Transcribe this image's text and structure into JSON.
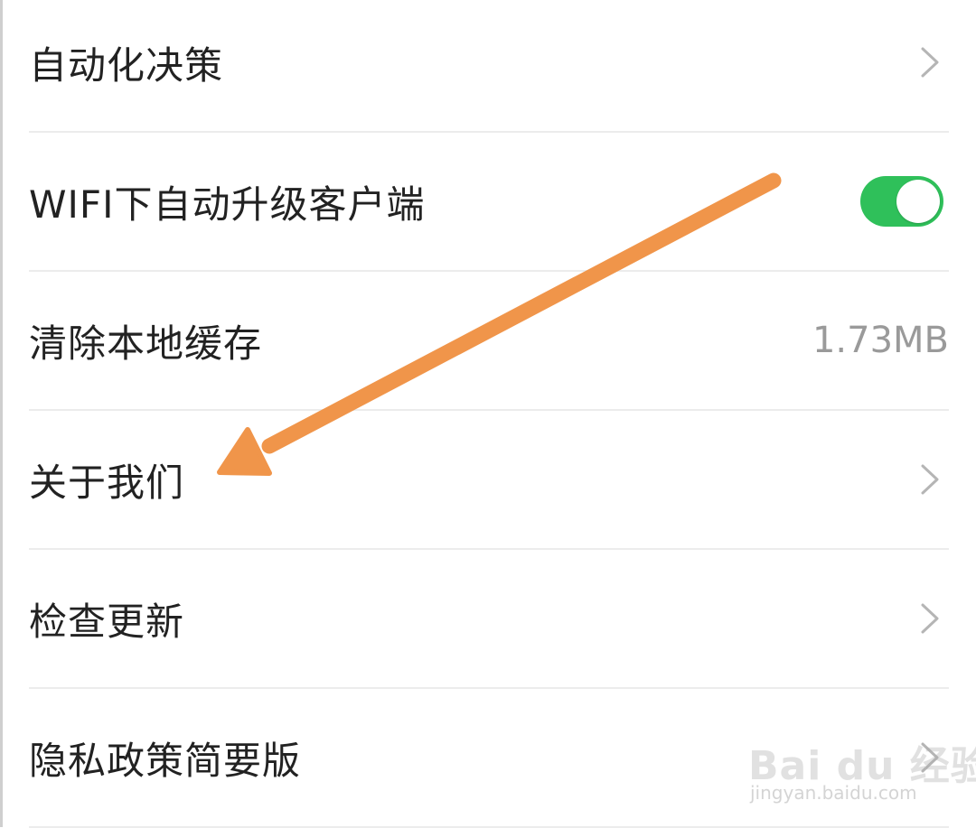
{
  "settings": {
    "items": [
      {
        "label": "自动化决策",
        "control": "chevron"
      },
      {
        "label": "WIFI下自动升级客户端",
        "control": "toggle",
        "toggle_on": true
      },
      {
        "label": "清除本地缓存",
        "control": "value",
        "value": "1.73MB"
      },
      {
        "label": "关于我们",
        "control": "chevron"
      },
      {
        "label": "检查更新",
        "control": "chevron"
      },
      {
        "label": "隐私政策简要版",
        "control": "chevron"
      }
    ]
  },
  "colors": {
    "toggle_on": "#2fc05a",
    "annotation_arrow": "#f0954a",
    "secondary_text": "#9a9a9a",
    "divider": "#ececec"
  },
  "icons": {
    "row_chevron": "chevron-right-icon"
  },
  "annotation": {
    "type": "arrow",
    "points_to": "关于我们"
  },
  "watermark": {
    "brand": "Bai du 经验",
    "url": "jingyan.baidu.com"
  }
}
